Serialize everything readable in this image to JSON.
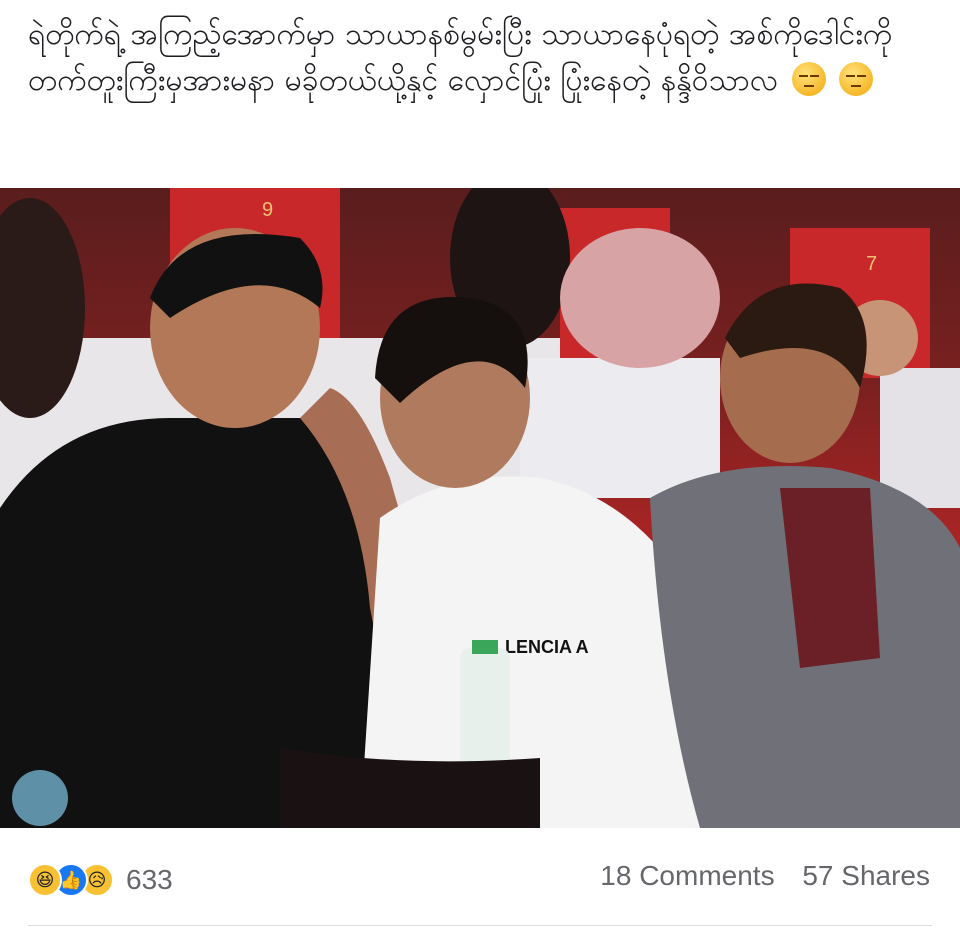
{
  "post": {
    "text": "ရဲတိုက်ရဲ့ အကြည့်အောက်မှာ သာယာနစ်မွမ်းပြီး သာယာနေပုံရတဲ့ အစ်ကိုဒေါင်းကို တက်တူးကြီးမှအားမနာ မခိုတယ်ယို့နှင့် လှောင်ပြုံး ပြုံးနေတဲ့ နန္ဒိဝိသာလ",
    "trailing_emojis": [
      "unamused-face",
      "unamused-face"
    ]
  },
  "photo": {
    "alt": "Three men sitting in red cinema seats",
    "seat_numbers": [
      "9",
      "7"
    ],
    "hoodie_text": "LENCIA A"
  },
  "footer": {
    "reactions": [
      "haha-icon",
      "like-icon",
      "sad-icon"
    ],
    "reaction_count": "633",
    "comments": "18 Comments",
    "shares": "57 Shares"
  },
  "colors": {
    "like_blue": "#1877f2",
    "emoji_yellow": "#f7c133",
    "meta_gray": "#65676b"
  }
}
